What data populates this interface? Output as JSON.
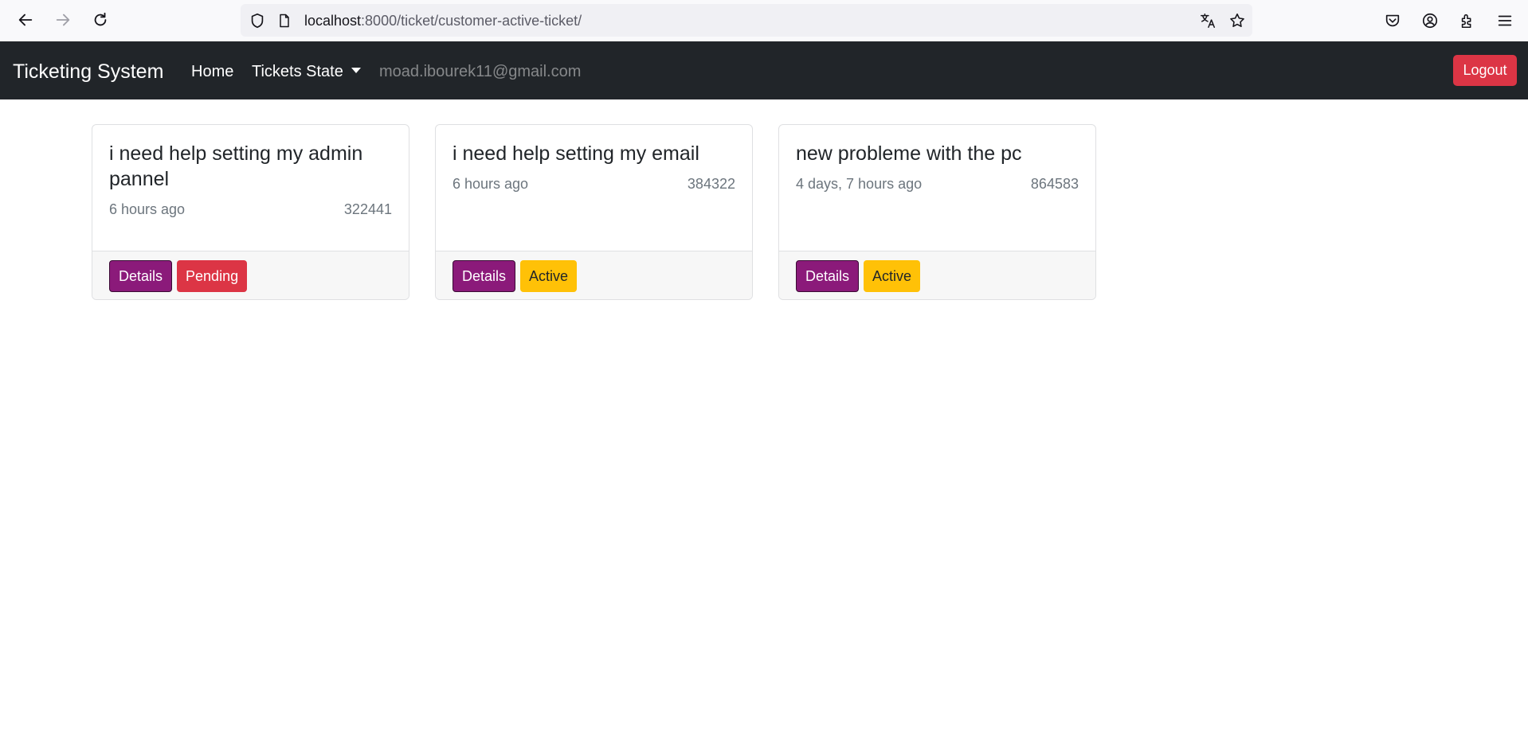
{
  "browser": {
    "url_host": "localhost",
    "url_path": ":8000/ticket/customer-active-ticket/"
  },
  "navbar": {
    "brand": "Ticketing System",
    "home_label": "Home",
    "tickets_state_label": "Tickets State",
    "user_email": "moad.ibourek11@gmail.com",
    "logout_label": "Logout"
  },
  "tickets": [
    {
      "title": "i need help setting my admin pannel",
      "time_ago": "6 hours ago",
      "ticket_id": "322441",
      "details_label": "Details",
      "status": "Pending",
      "status_color": "#dc3545"
    },
    {
      "title": "i need help setting my email",
      "time_ago": "6 hours ago",
      "ticket_id": "384322",
      "details_label": "Details",
      "status": "Active",
      "status_color": "#ffc107"
    },
    {
      "title": "new probleme with the pc",
      "time_ago": "4 days, 7 hours ago",
      "ticket_id": "864583",
      "details_label": "Details",
      "status": "Active",
      "status_color": "#ffc107"
    }
  ],
  "colors": {
    "navbar_bg": "#212529",
    "details_button": "#8b1a7a",
    "logout_button": "#dc3545"
  }
}
